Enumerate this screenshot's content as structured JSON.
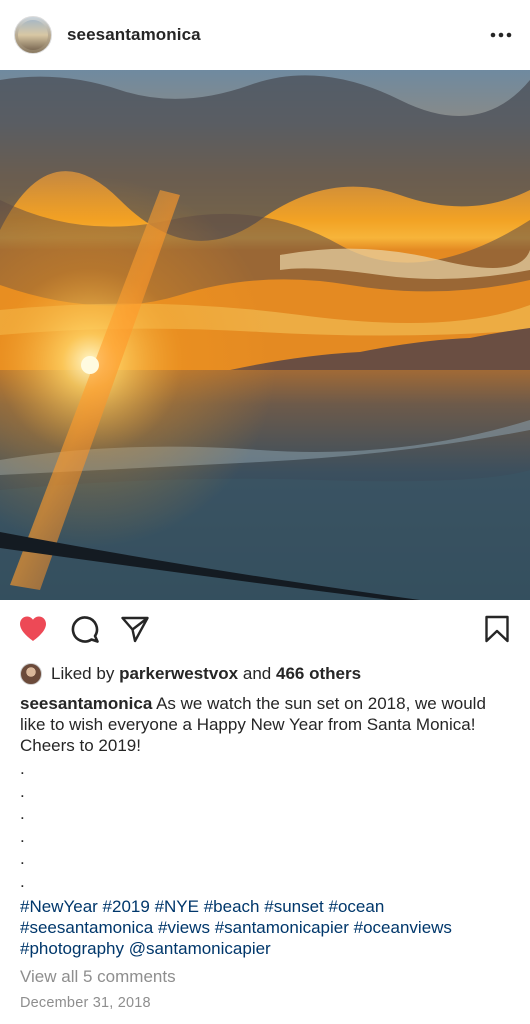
{
  "header": {
    "username": "seesantamonica",
    "more_icon": "ellipsis-icon"
  },
  "photo": {
    "description_icon": "sunset-photo"
  },
  "actions": {
    "like_icon": "heart-icon",
    "comment_icon": "comment-icon",
    "share_icon": "send-icon",
    "save_icon": "bookmark-icon",
    "like_color": "#ed4956"
  },
  "likes": {
    "prefix": "Liked by",
    "user": "parkerwestvox",
    "middle": "and",
    "others": "466 others"
  },
  "caption": {
    "username": "seesantamonica",
    "text": "As we watch the sun set on 2018, we would like to wish everyone a Happy New Year from Santa Monica! Cheers to 2019!",
    "dots": [
      ".",
      ".",
      ".",
      ".",
      ".",
      "."
    ],
    "tags": [
      "#NewYear",
      "#2019",
      "#NYE",
      "#beach",
      "#sunset",
      "#ocean",
      "#seesantamonica",
      "#views",
      "#santamonicapier",
      "#oceanviews",
      "#photography",
      "@santamonicapier"
    ]
  },
  "comments": {
    "view_all": "View all 5 comments"
  },
  "date": "December 31, 2018",
  "colors": {
    "link": "#00376b",
    "muted": "#8e8e8e",
    "text": "#262626"
  }
}
